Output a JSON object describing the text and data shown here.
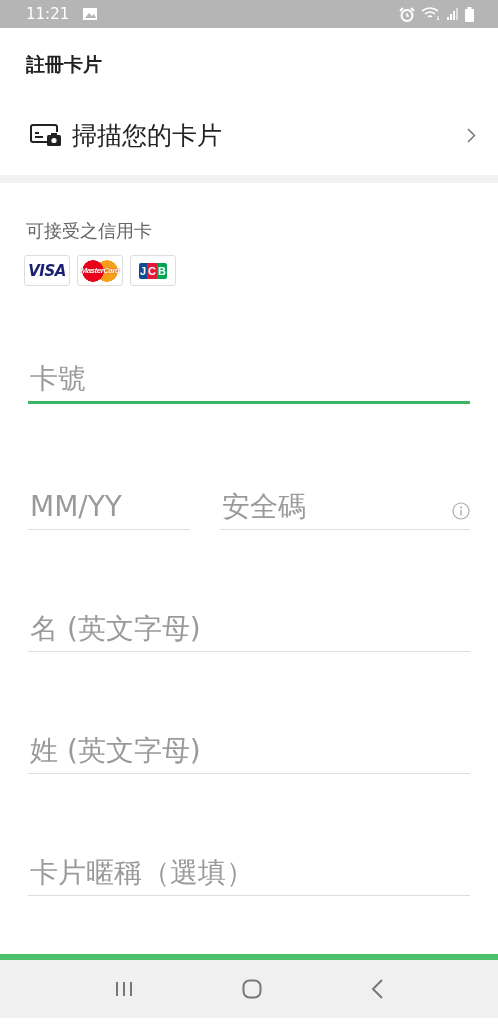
{
  "status_bar": {
    "time": "11:21"
  },
  "header": {
    "title": "註冊卡片"
  },
  "scan_row": {
    "label": "掃描您的卡片"
  },
  "accepted_cards": {
    "label": "可接受之信用卡",
    "cards": [
      {
        "kind": "visa",
        "label": "VISA"
      },
      {
        "kind": "mastercard",
        "label": "MasterCard"
      },
      {
        "kind": "jcb",
        "label": "JCB"
      }
    ]
  },
  "fields": [
    {
      "placeholder": "卡號",
      "focused": true,
      "kind": "text"
    },
    {
      "kind": "pair",
      "parts": [
        {
          "placeholder": "MM/YY",
          "focused": false,
          "info": false
        },
        {
          "placeholder": "安全碼",
          "focused": false,
          "info": true
        }
      ]
    },
    {
      "placeholder": "名 (英文字母)",
      "focused": false,
      "kind": "text"
    },
    {
      "placeholder": "姓 (英文字母)",
      "focused": false,
      "kind": "text"
    },
    {
      "placeholder": "卡片暱稱（選填）",
      "focused": false,
      "kind": "text"
    }
  ]
}
